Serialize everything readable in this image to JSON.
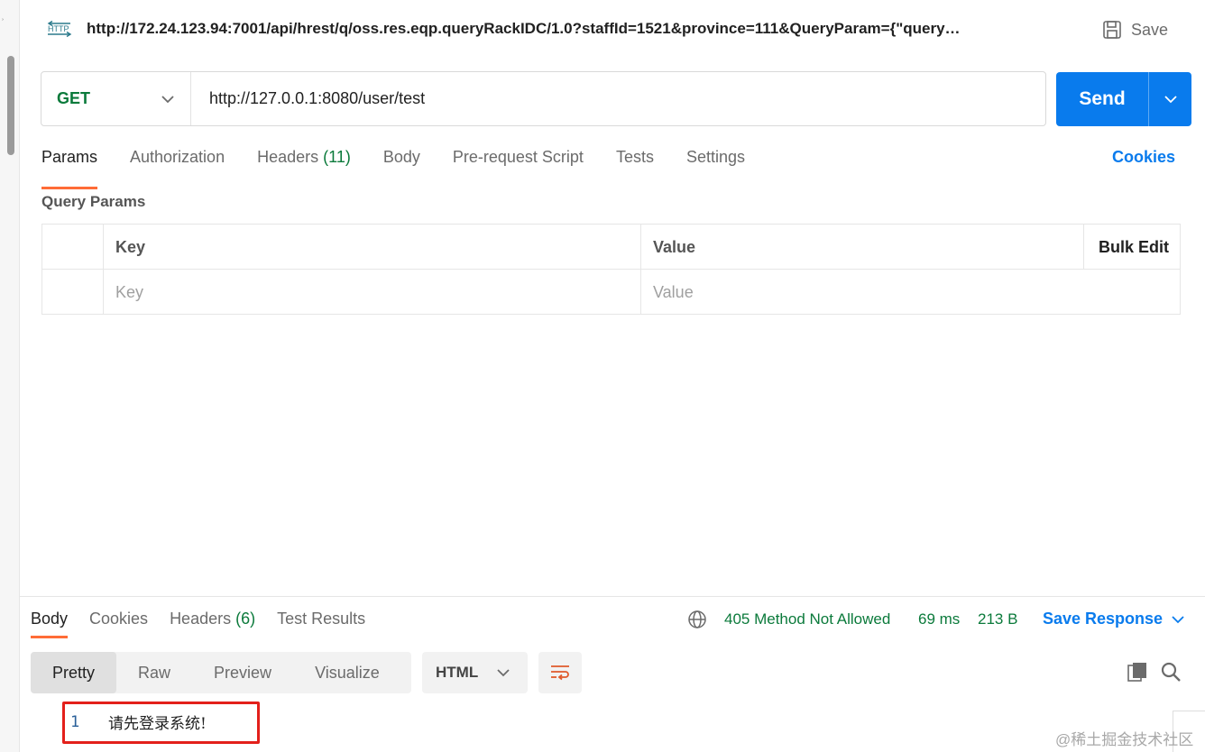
{
  "request": {
    "title": "http://172.24.123.94:7001/api/hrest/q/oss.res.eqp.queryRackIDC/1.0?staffId=1521&province=111&QueryParam={\"query…",
    "save_label": "Save",
    "method": "GET",
    "url": "http://127.0.0.1:8080/user/test",
    "send_label": "Send"
  },
  "request_tabs": {
    "params": "Params",
    "authorization": "Authorization",
    "headers": "Headers",
    "headers_count": "(11)",
    "body": "Body",
    "prerequest": "Pre-request Script",
    "tests": "Tests",
    "settings": "Settings",
    "cookies": "Cookies"
  },
  "query_params": {
    "label": "Query Params",
    "columns": {
      "key": "Key",
      "value": "Value",
      "bulk_edit": "Bulk Edit"
    },
    "placeholder_key": "Key",
    "placeholder_value": "Value"
  },
  "response": {
    "tabs": {
      "body": "Body",
      "cookies": "Cookies",
      "headers": "Headers",
      "headers_count": "(6)",
      "test_results": "Test Results"
    },
    "status": "405 Method Not Allowed",
    "time": "69 ms",
    "size": "213 B",
    "save_response": "Save Response",
    "views": {
      "pretty": "Pretty",
      "raw": "Raw",
      "preview": "Preview",
      "visualize": "Visualize"
    },
    "format": "HTML",
    "lines": [
      {
        "num": "1",
        "text": "请先登录系统!"
      }
    ]
  },
  "watermark": "@稀土掘金技术社区",
  "colors": {
    "accent": "#097bed",
    "success": "#0b7a3b",
    "tab_active": "#ff6c37",
    "highlight": "#e3201b"
  }
}
